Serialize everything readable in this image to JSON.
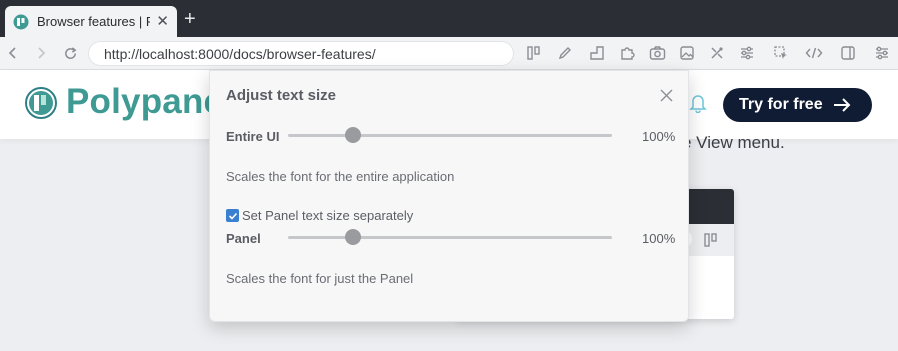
{
  "browser": {
    "tab": {
      "title": "Browser features | Po",
      "close_glyph": "✕"
    },
    "new_tab_glyph": "+",
    "url": "http://localhost:8000/docs/browser-features/",
    "toolbar_icons": [
      "panel-icon",
      "pen-icon",
      "ruler-icon",
      "extension-icon",
      "camera-icon",
      "image-icon",
      "tools-icon",
      "sliders-icon",
      "cursor-icon",
      "code-icon",
      "sidebar-icon",
      "settings-icon"
    ]
  },
  "site": {
    "brand": "Polypane",
    "cta_label": "Try for free",
    "behind_text": "e View menu."
  },
  "popup": {
    "title": "Adjust text size",
    "rows": [
      {
        "label": "Entire UI",
        "value_text": "100%",
        "value_fraction": 0.2,
        "description": "Scales the font for the entire application"
      },
      {
        "label": "Panel",
        "value_text": "100%",
        "value_fraction": 0.2,
        "description": "Scales the font for just the Panel"
      }
    ],
    "checkbox": {
      "label": "Set Panel text size separately",
      "checked": true
    }
  },
  "colors": {
    "accent": "#3b7fd0",
    "brand_teal": "#3e9a93",
    "cta_bg": "#0f1c33",
    "tab_strip_bg": "#2b2e35"
  }
}
